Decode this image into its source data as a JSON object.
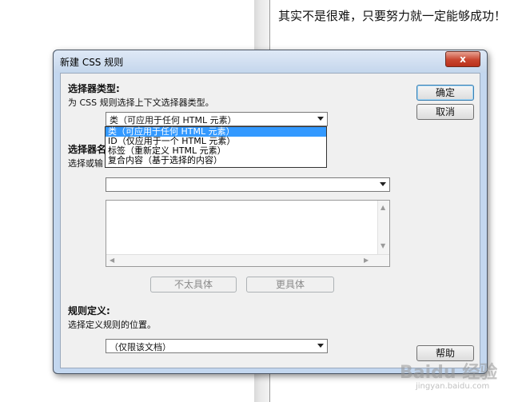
{
  "background": {
    "sentence": "其实不是很难，只要努力就一定能够成功！"
  },
  "dialog": {
    "title": "新建 CSS 规则",
    "close_label": "x",
    "selector_type": {
      "heading": "选择器类型:",
      "description": "为 CSS 规则选择上下文选择器类型。",
      "selected": "类（可应用于任何 HTML 元素）",
      "options": [
        "类（可应用于任何 HTML 元素）",
        "ID（仅应用于一个 HTML 元素）",
        "标签（重新定义 HTML 元素）",
        "复合内容（基于选择的内容）"
      ]
    },
    "selector_name": {
      "heading": "选择器名",
      "description": "选择或输",
      "value": ""
    },
    "specificity": {
      "less_label": "不太具体",
      "more_label": "更具体"
    },
    "rule_definition": {
      "heading": "规则定义:",
      "description": "选择定义规则的位置。",
      "selected": "（仅限该文档）"
    },
    "buttons": {
      "ok": "确定",
      "cancel": "取消",
      "help": "帮助"
    }
  },
  "watermark": {
    "text": "Baidu 经验",
    "sub": "jingyan.baidu.com"
  }
}
